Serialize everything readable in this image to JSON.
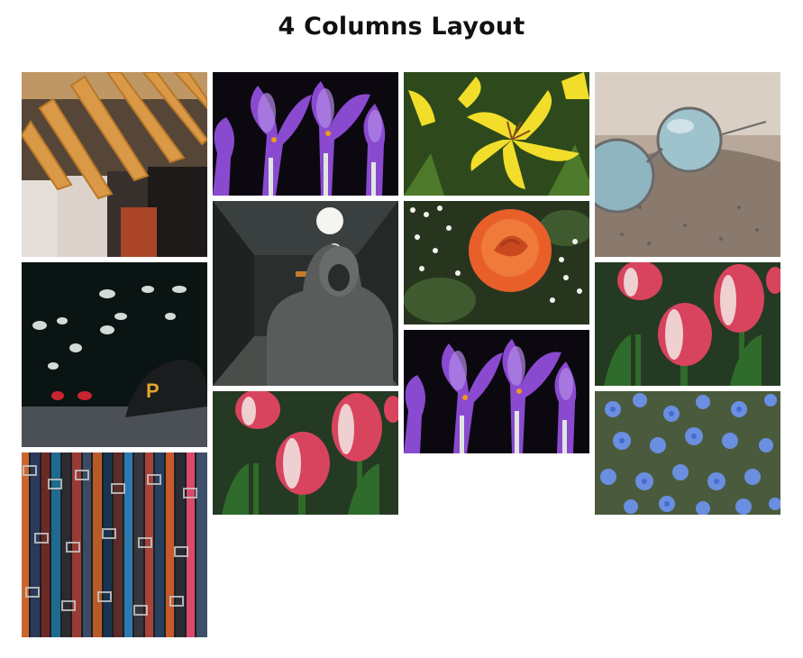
{
  "page": {
    "title": "4 Columns Layout"
  },
  "gallery": {
    "columns": [
      {
        "name": "column-1",
        "images": [
          {
            "name": "clothes-hangers-image",
            "label": "Clothes on wooden hangers",
            "h": 205
          },
          {
            "name": "baseball-cap-image",
            "label": "Cap on street with bokeh lights",
            "h": 205
          },
          {
            "name": "leather-belts-image",
            "label": "Hanging leather belts",
            "h": 205
          }
        ]
      },
      {
        "name": "column-2",
        "images": [
          {
            "name": "purple-crocus-image",
            "label": "Purple crocus flowers",
            "h": 137
          },
          {
            "name": "hooded-person-subway-image",
            "label": "Hooded person in subway",
            "h": 205
          },
          {
            "name": "tulips-image",
            "label": "Pink and white tulips",
            "h": 137
          }
        ]
      },
      {
        "name": "column-3",
        "images": [
          {
            "name": "yellow-lily-image",
            "label": "Yellow lily flowers",
            "h": 137
          },
          {
            "name": "orange-rose-image",
            "label": "Orange rose with white flowers",
            "h": 137
          },
          {
            "name": "purple-crocus-image-2",
            "label": "Purple crocus flowers",
            "h": 137
          }
        ]
      },
      {
        "name": "column-4",
        "images": [
          {
            "name": "sunglasses-image",
            "label": "Round sunglasses on rock",
            "h": 205
          },
          {
            "name": "tulips-image-2",
            "label": "Pink and white tulips",
            "h": 137
          },
          {
            "name": "blue-flowers-image",
            "label": "Blue flax flowers",
            "h": 137
          }
        ]
      }
    ]
  }
}
